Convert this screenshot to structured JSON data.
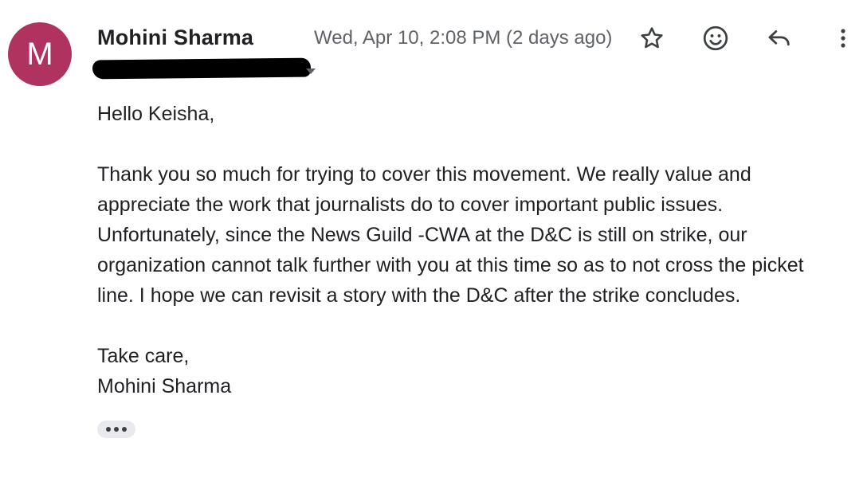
{
  "sender": {
    "avatar_letter": "M",
    "avatar_color": "#b0325f",
    "name": "Mohini Sharma",
    "email_redacted": true
  },
  "timestamp": "Wed, Apr 10, 2:08 PM (2 days ago)",
  "actions": {
    "icons": [
      "star-icon",
      "emoji-icon",
      "reply-icon",
      "more-vert-icon"
    ]
  },
  "message": {
    "greeting": "Hello Keisha,",
    "body_lines": [
      "Thank you so much for trying to cover this movement. We really value and",
      "appreciate the work that journalists do to cover important public issues.",
      "Unfortunately, since the News Guild -CWA at the D&C is still on strike, our",
      "organization cannot talk further with you at this time so as to not cross the picket",
      "line. I hope we can revisit a story with the D&C after the strike concludes."
    ],
    "closing": "Take care,",
    "signature": "Mohini Sharma"
  },
  "colors": {
    "text_primary": "#202124",
    "text_secondary": "#5f6368",
    "chip_background": "#e8eaed"
  }
}
